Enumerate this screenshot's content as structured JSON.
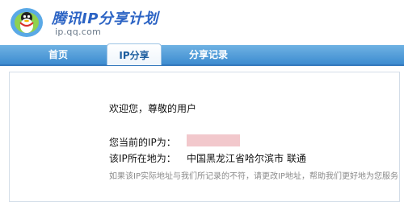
{
  "header": {
    "title": "腾讯IP分享计划",
    "domain": "ip.qq.com",
    "logo_icon": "qq-penguin-icon"
  },
  "nav": {
    "tabs": [
      {
        "label": "首页",
        "active": false
      },
      {
        "label": "IP分享",
        "active": true
      },
      {
        "label": "分享记录",
        "active": false
      }
    ]
  },
  "main": {
    "welcome": "欢迎您，尊敬的用户",
    "ip_label": "您当前的IP为：",
    "location_label": "该IP所在地为：",
    "location_value": "中国黑龙江省哈尔滨市 联通",
    "notice": "如果该IP实际地址与我们所记录的不符，请更改IP地址，帮助我们更好地为您服务"
  },
  "colors": {
    "nav_blue": "#3d8cd0",
    "title_blue": "#2b63c4",
    "redacted_ip": "#f2c8cc"
  }
}
